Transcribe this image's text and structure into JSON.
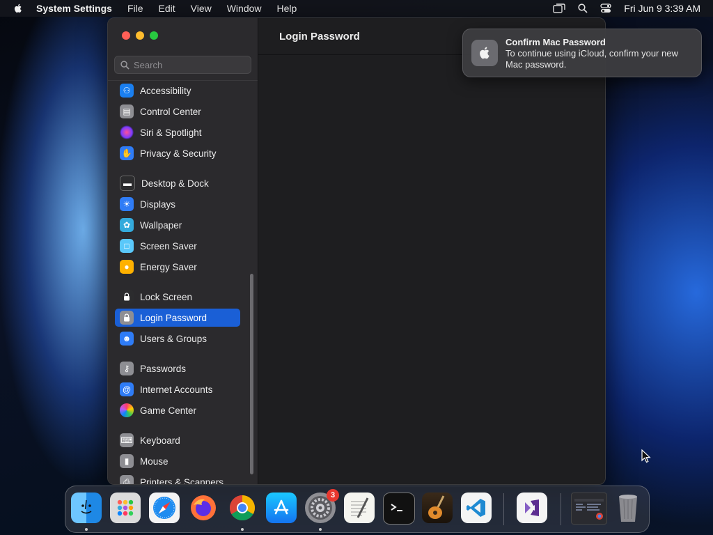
{
  "menubar": {
    "app_name": "System Settings",
    "menus": [
      "File",
      "Edit",
      "View",
      "Window",
      "Help"
    ],
    "clock": "Fri Jun 9  3:39 AM",
    "status_icons": [
      "screen-mirroring-icon",
      "spotlight-search-icon",
      "control-center-icon"
    ]
  },
  "window": {
    "search_placeholder": "Search",
    "content_title": "Login Password",
    "sidebar": {
      "items": [
        {
          "label": "Accessibility",
          "icon": "accessibility-icon",
          "color": "#1a7ff0"
        },
        {
          "label": "Control Center",
          "icon": "control-center-icon",
          "color": "#8e8e93"
        },
        {
          "label": "Siri & Spotlight",
          "icon": "siri-icon",
          "color": "#b03ad8"
        },
        {
          "label": "Privacy & Security",
          "icon": "hand-icon",
          "color": "#2f7cf6"
        },
        {
          "label": "Desktop & Dock",
          "icon": "dock-icon",
          "color": "#2c2c2e"
        },
        {
          "label": "Displays",
          "icon": "sun-icon",
          "color": "#2f7cf6"
        },
        {
          "label": "Wallpaper",
          "icon": "flower-icon",
          "color": "#34aadc"
        },
        {
          "label": "Screen Saver",
          "icon": "screen-saver-icon",
          "color": "#5ac8fa"
        },
        {
          "label": "Energy Saver",
          "icon": "bulb-icon",
          "color": "#ffb100"
        },
        {
          "label": "Lock Screen",
          "icon": "lock-icon",
          "color": "#2c2c2e"
        },
        {
          "label": "Login Password",
          "icon": "lock-icon",
          "color": "#8e8e93"
        },
        {
          "label": "Users & Groups",
          "icon": "users-icon",
          "color": "#2f7cf6"
        },
        {
          "label": "Passwords",
          "icon": "key-icon",
          "color": "#8e8e93"
        },
        {
          "label": "Internet Accounts",
          "icon": "at-icon",
          "color": "#2f7cf6"
        },
        {
          "label": "Game Center",
          "icon": "game-center-icon",
          "color": "#f2f2f2"
        },
        {
          "label": "Keyboard",
          "icon": "keyboard-icon",
          "color": "#8e8e93"
        },
        {
          "label": "Mouse",
          "icon": "mouse-icon",
          "color": "#8e8e93"
        },
        {
          "label": "Printers & Scanners",
          "icon": "printer-icon",
          "color": "#8e8e93"
        }
      ],
      "selected": "Login Password"
    }
  },
  "notification": {
    "title": "Confirm Mac Password",
    "body": "To continue using iCloud, confirm your new Mac password.",
    "icon": "apple-logo-icon"
  },
  "dock": {
    "apps": [
      {
        "name": "finder-icon",
        "running": true
      },
      {
        "name": "launchpad-icon",
        "running": false
      },
      {
        "name": "safari-icon",
        "running": false
      },
      {
        "name": "firefox-icon",
        "running": false
      },
      {
        "name": "chrome-icon",
        "running": true
      },
      {
        "name": "app-store-icon",
        "running": false
      },
      {
        "name": "system-settings-icon",
        "running": true,
        "badge": "3"
      },
      {
        "name": "textedit-icon",
        "running": false
      },
      {
        "name": "terminal-icon",
        "running": false
      },
      {
        "name": "garageband-icon",
        "running": false
      },
      {
        "name": "vscode-icon",
        "running": false
      },
      {
        "name": "visual-studio-icon",
        "running": false
      },
      {
        "name": "minimized-window-icon",
        "running": false
      },
      {
        "name": "trash-icon",
        "running": false
      }
    ]
  }
}
